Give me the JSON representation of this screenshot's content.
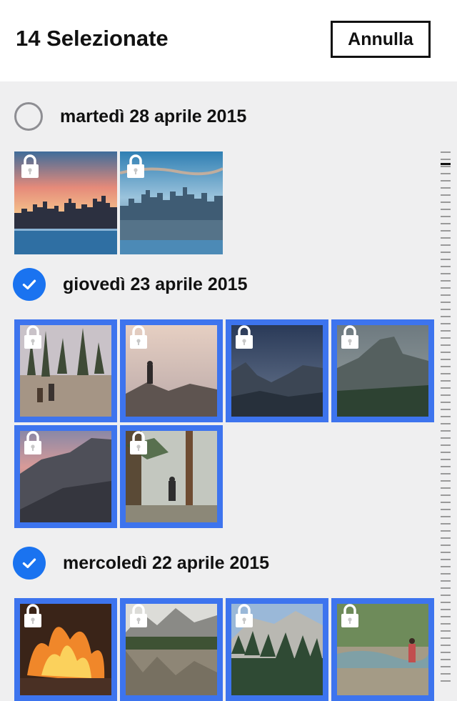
{
  "header": {
    "title": "14 Selezionate",
    "cancel_label": "Annulla"
  },
  "sections": [
    {
      "date": "martedì 28 aprile 2015",
      "selected": false,
      "photos": [
        "city-skyline-sunset",
        "city-skyline-aerial"
      ]
    },
    {
      "date": "giovedì 23 aprile 2015",
      "selected": true,
      "photos": [
        "hikers-forest",
        "photographer-cliff",
        "valley-night",
        "half-dome-valley",
        "half-dome-sunset",
        "hiker-trees"
      ]
    },
    {
      "date": "mercoledì 22 aprile 2015",
      "selected": true,
      "photos": [
        "campfire",
        "mountain-lake-reflection",
        "mountain-forest",
        "hiker-river"
      ]
    }
  ],
  "colors": {
    "accent": "#1a73f0",
    "selection_border": "#3d74ee",
    "background": "#efeff0"
  },
  "icons": {
    "lock": "lock-icon",
    "check": "checkmark-icon"
  }
}
